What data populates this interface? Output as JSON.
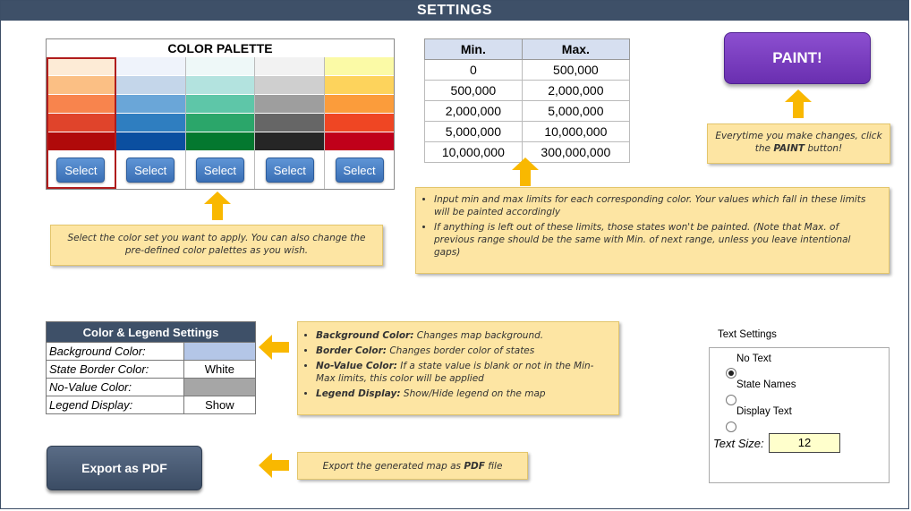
{
  "header": {
    "title": "SETTINGS"
  },
  "palette": {
    "title": "COLOR PALETTE",
    "selected_index": 0,
    "columns": [
      {
        "colors": [
          "#fdebd6",
          "#fbbf84",
          "#f8844d",
          "#e0442b",
          "#b00a0a"
        ],
        "button": "Select"
      },
      {
        "colors": [
          "#eff3fb",
          "#c4d6ea",
          "#6aa6d8",
          "#2f7ec0",
          "#0b4fa0"
        ],
        "button": "Select"
      },
      {
        "colors": [
          "#eef8f8",
          "#b3e3df",
          "#5ec6a8",
          "#2ba66a",
          "#04782f"
        ],
        "button": "Select"
      },
      {
        "colors": [
          "#f2f2f2",
          "#cfcfcf",
          "#9e9e9e",
          "#666666",
          "#262626"
        ],
        "button": "Select"
      },
      {
        "colors": [
          "#fbfaa6",
          "#fdd35c",
          "#fb9c3b",
          "#ef4623",
          "#c0001a"
        ],
        "button": "Select"
      }
    ]
  },
  "ranges": {
    "headers": [
      "Min.",
      "Max."
    ],
    "rows": [
      [
        "0",
        "500,000"
      ],
      [
        "500,000",
        "2,000,000"
      ],
      [
        "2,000,000",
        "5,000,000"
      ],
      [
        "5,000,000",
        "10,000,000"
      ],
      [
        "10,000,000",
        "300,000,000"
      ]
    ]
  },
  "paint_button": "PAINT!",
  "notes": {
    "paint": "Everytime you make changes, click the PAINT button!",
    "paint_pre": "Everytime you make changes, click the ",
    "paint_bold": "PAINT",
    "paint_post": " button!",
    "palette": "Select the color set you want to apply. You can also change the pre-defined color palettes as you wish.",
    "ranges_1": "Input min and max limits for each corresponding color. Your values which fall in these limits will be painted accordingly",
    "ranges_2": "If anything is left out of these limits, those states won't be painted. (Note that Max. of previous range should be the same with Min. of next range, unless you leave intentional gaps)",
    "legend_items": [
      {
        "bold": "Background Color:",
        "text": " Changes map background."
      },
      {
        "bold": "Border Color:",
        "text": " Changes border color of states"
      },
      {
        "bold": "No-Value Color:",
        "text": " If a state value is blank or not in the Min-Max limits, this color will be applied"
      },
      {
        "bold": "Legend Display:",
        "text": " Show/Hide legend on the map"
      }
    ],
    "export_pre": "Export the generated map as ",
    "export_bold": "PDF",
    "export_post": " file"
  },
  "legend_settings": {
    "title": "Color & Legend Settings",
    "rows": [
      {
        "label": "Background Color:",
        "value": "",
        "color": "#b4c6e7"
      },
      {
        "label": "State Border Color:",
        "value": "White",
        "color": "#ffffff"
      },
      {
        "label": "No-Value Color:",
        "value": "",
        "color": "#a6a6a6"
      },
      {
        "label": "Legend Display:",
        "value": "Show",
        "color": "#ffffff"
      }
    ]
  },
  "export_button": "Export as PDF",
  "text_settings": {
    "title": "Text Settings",
    "options": [
      "No Text",
      "State Names",
      "Display Text"
    ],
    "selected": "State Names",
    "size_label": "Text Size:",
    "size_value": "12"
  },
  "colors": {
    "header": "#3e5068",
    "arrow": "#f9b800",
    "note_bg": "#fde5a3",
    "paint": "#7a3fc4"
  }
}
